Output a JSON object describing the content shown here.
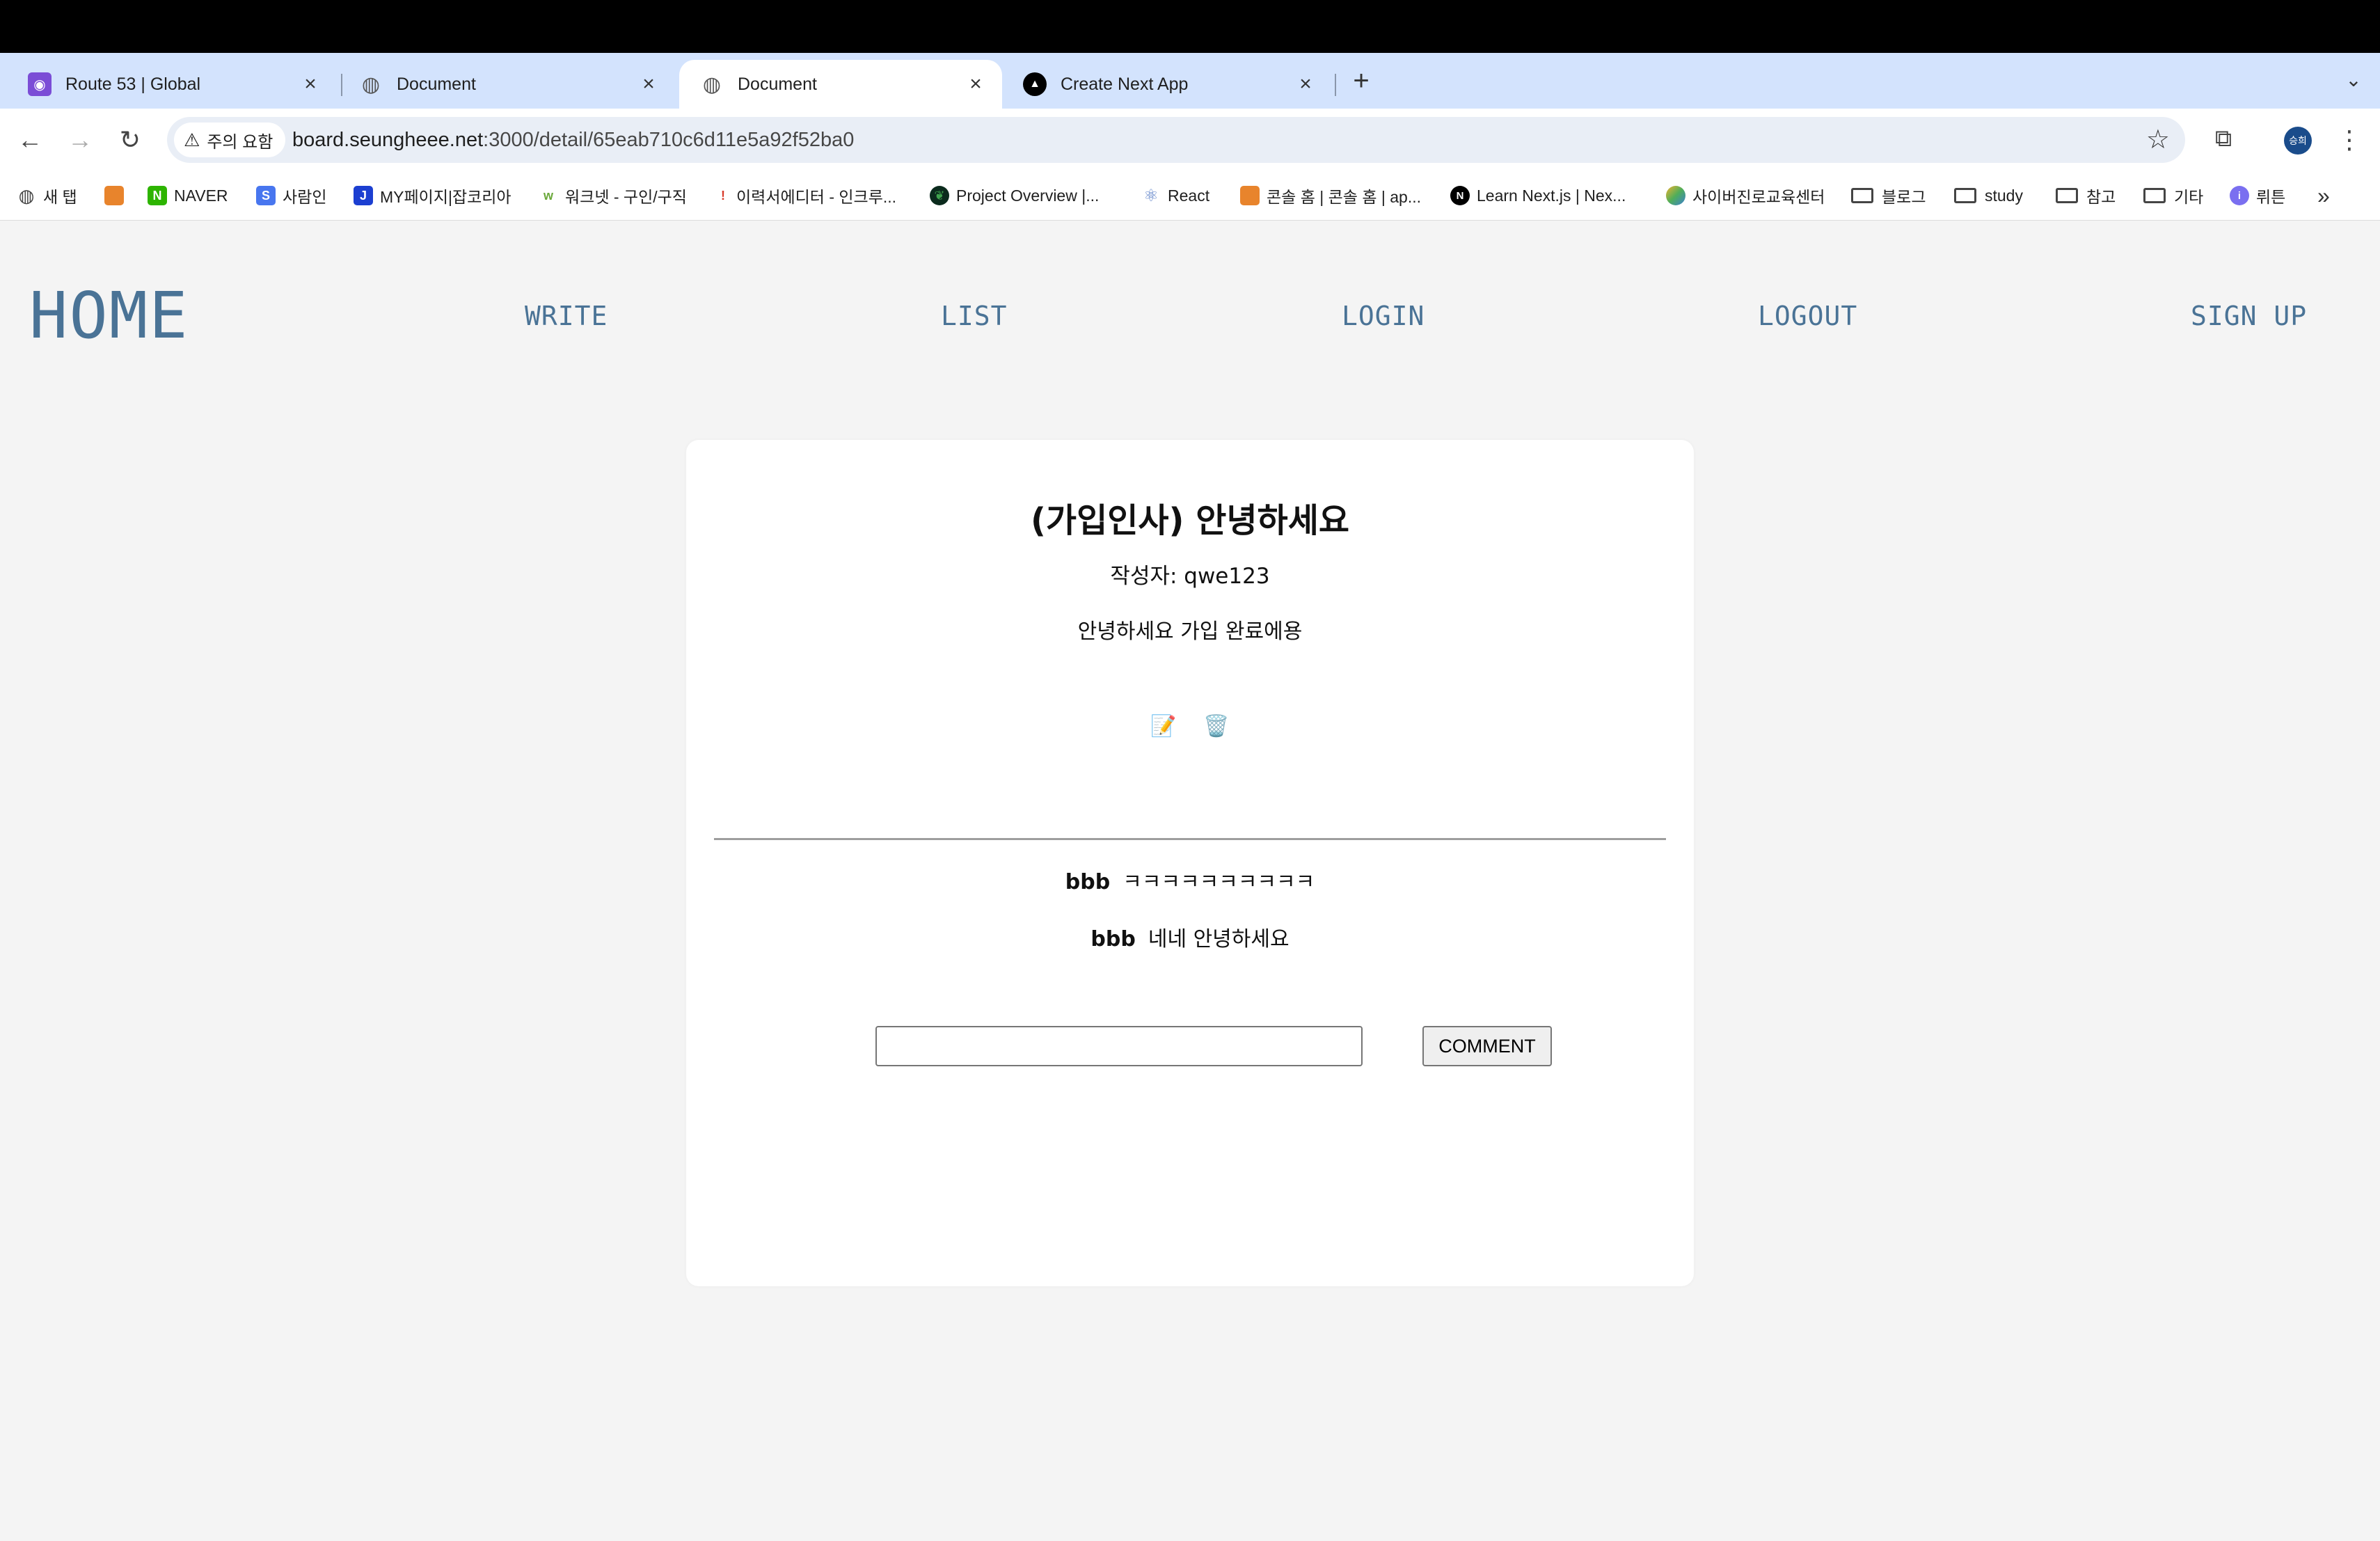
{
  "browser": {
    "tabs": [
      {
        "title": "Route 53 | Global",
        "icon": "route53-icon",
        "active": false
      },
      {
        "title": "Document",
        "icon": "globe-icon",
        "active": false
      },
      {
        "title": "Document",
        "icon": "globe-icon",
        "active": true
      },
      {
        "title": "Create Next App",
        "icon": "nextjs-icon",
        "active": false
      }
    ],
    "security_label": "주의 요함",
    "url_host": "board.seungheee.net",
    "url_path": ":3000/detail/65eab710c6d11e5a92f52ba0",
    "profile_initials": "승희",
    "bookmarks": [
      {
        "label": "새 탭",
        "icon": "globe-icon"
      },
      {
        "label": "",
        "icon": "box-icon"
      },
      {
        "label": "NAVER",
        "icon": "naver-icon"
      },
      {
        "label": "사람인",
        "icon": "saramin-icon"
      },
      {
        "label": "MY페이지|잡코리아",
        "icon": "jobkorea-icon"
      },
      {
        "label": "워크넷 - 구인/구직",
        "icon": "worknet-icon"
      },
      {
        "label": "이력서에디터 - 인크루...",
        "icon": "incruit-icon"
      },
      {
        "label": "Project Overview |...",
        "icon": "mongodb-icon"
      },
      {
        "label": "React",
        "icon": "react-icon"
      },
      {
        "label": "콘솔 홈 | 콘솔 홈 | ap...",
        "icon": "aws-icon"
      },
      {
        "label": "Learn Next.js | Nex...",
        "icon": "nextjs-icon"
      },
      {
        "label": "사이버진로교육센터",
        "icon": "career-icon"
      },
      {
        "label": "블로그",
        "icon": "folder-icon"
      },
      {
        "label": "study",
        "icon": "folder-icon"
      },
      {
        "label": "참고",
        "icon": "folder-icon"
      },
      {
        "label": "기타",
        "icon": "folder-icon"
      },
      {
        "label": "뤼튼",
        "icon": "wrtn-icon"
      }
    ]
  },
  "nav": {
    "home": "HOME",
    "write": "WRITE",
    "list": "LIST",
    "login": "LOGIN",
    "logout": "LOGOUT",
    "signup": "SIGN UP"
  },
  "post": {
    "title": "(가입인사) 안녕하세요",
    "author": "작성자: qwe123",
    "content": "안녕하세요 가입 완료에용",
    "edit_icon": "📝",
    "delete_icon": "🗑️"
  },
  "comments": [
    {
      "user": "bbb",
      "text": "ㅋㅋㅋㅋㅋㅋㅋㅋㅋㅋ"
    },
    {
      "user": "bbb",
      "text": "네네 안녕하세요"
    }
  ],
  "comment_form": {
    "input_value": "",
    "button_label": "COMMENT"
  },
  "colors": {
    "nav_link": "#4a7396",
    "page_bg": "#f4f4f4",
    "tabstrip": "#d3e3fd"
  }
}
